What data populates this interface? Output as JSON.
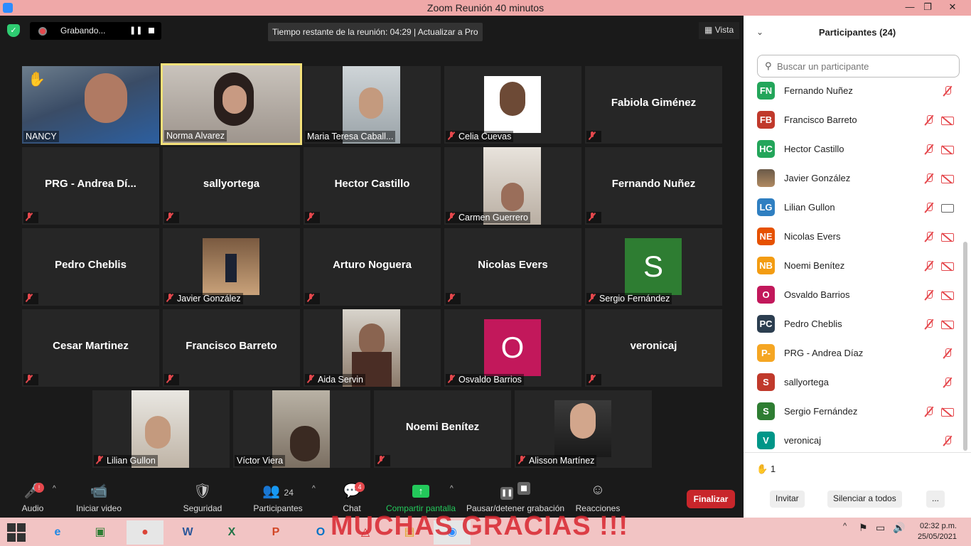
{
  "window": {
    "title": "Zoom Reunión 40 minutos"
  },
  "meeting": {
    "recording_label": "Grabando...",
    "time_banner": "Tiempo restante de la reunión: 04:29 | Actualizar a Pro",
    "view_label": "Vista"
  },
  "tiles": [
    {
      "name": "NANCY",
      "muted": false,
      "hand": true
    },
    {
      "name": "Norma Alvarez",
      "muted": false,
      "active": true
    },
    {
      "name": "Maria Teresa Caball...",
      "muted": false
    },
    {
      "name": "Celia Cuevas",
      "muted": true
    },
    {
      "name": "Fabiola Giménez",
      "muted": true
    },
    {
      "name": "PRG - Andrea Dí...",
      "muted": true
    },
    {
      "name": "sallyortega",
      "muted": true
    },
    {
      "name": "Hector Castillo",
      "muted": true
    },
    {
      "name": "Carmen Guerrero",
      "muted": true
    },
    {
      "name": "Fernando Nuñez",
      "muted": true
    },
    {
      "name": "Pedro Cheblis",
      "muted": true
    },
    {
      "name": "Javier González",
      "muted": true
    },
    {
      "name": "Arturo Noguera",
      "muted": true
    },
    {
      "name": "Nicolas Evers",
      "muted": true
    },
    {
      "name": "Sergio Fernández",
      "muted": true
    },
    {
      "name": "Cesar Martinez",
      "muted": true
    },
    {
      "name": "Francisco Barreto",
      "muted": true
    },
    {
      "name": "Aida Servin",
      "muted": true
    },
    {
      "name": "Osvaldo Barrios",
      "muted": true
    },
    {
      "name": "veronicaj",
      "muted": true
    },
    {
      "name": "Lilian Gullon",
      "muted": true
    },
    {
      "name": "Víctor Viera",
      "muted": false
    },
    {
      "name": "Noemi Benítez",
      "muted": true
    },
    {
      "name": "Alisson Martínez",
      "muted": true
    }
  ],
  "avatars": {
    "sergio": "S",
    "osvaldo": "O"
  },
  "toolbar": {
    "audio": "Audio",
    "audio_badge": "!",
    "video": "Iniciar video",
    "security": "Seguridad",
    "participants": "Participantes",
    "participants_count": "24",
    "chat": "Chat",
    "chat_badge": "4",
    "share": "Compartir pantalla",
    "record": "Pausar/detener grabación",
    "reactions": "Reacciones",
    "end": "Finalizar"
  },
  "panel": {
    "title": "Participantes (24)",
    "search_placeholder": "Buscar un participante",
    "participants": [
      {
        "initials": "FN",
        "name": "Fernando Nuñez",
        "color": "#23a55a",
        "video": null
      },
      {
        "initials": "FB",
        "name": "Francisco Barreto",
        "color": "#c0392b",
        "video": "off"
      },
      {
        "initials": "HC",
        "name": "Hector Castillo",
        "color": "#23a55a",
        "video": "off"
      },
      {
        "initials": "",
        "name": "Javier González",
        "color": "#8a6d4a",
        "video": "off"
      },
      {
        "initials": "LG",
        "name": "Lilian Gullon",
        "color": "#2f7fc1",
        "video": "on"
      },
      {
        "initials": "NE",
        "name": "Nicolas Evers",
        "color": "#e65100",
        "video": "off"
      },
      {
        "initials": "NB",
        "name": "Noemi Benítez",
        "color": "#f39c12",
        "video": "off"
      },
      {
        "initials": "O",
        "name": "Osvaldo Barrios",
        "color": "#c2185b",
        "video": "off"
      },
      {
        "initials": "PC",
        "name": "Pedro Cheblis",
        "color": "#2c3e50",
        "video": "off"
      },
      {
        "initials": "P-",
        "name": "PRG - Andrea Díaz",
        "color": "#f5a623",
        "video": null
      },
      {
        "initials": "S",
        "name": "sallyortega",
        "color": "#c0392b",
        "video": null
      },
      {
        "initials": "S",
        "name": "Sergio Fernández",
        "color": "#2e7d32",
        "video": "off"
      },
      {
        "initials": "V",
        "name": "veronicaj",
        "color": "#009688",
        "video": null
      }
    ],
    "raised_hands": "1",
    "invite": "Invitar",
    "mute_all": "Silenciar a todos",
    "more": "..."
  },
  "taskbar": {
    "watermark": "MUCHAS GRACIAS !!!",
    "time": "02:32 p.m.",
    "date": "25/05/2021"
  }
}
